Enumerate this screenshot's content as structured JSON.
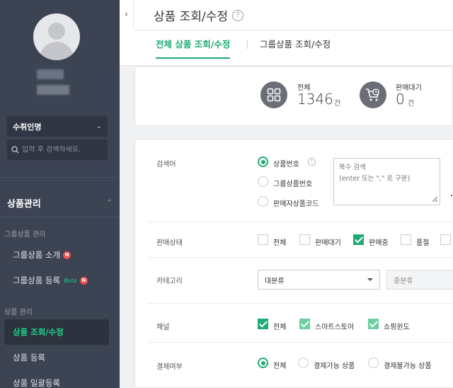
{
  "sidebar": {
    "store_select": "수취인명",
    "search_placeholder": "입력 후 검색하세요.",
    "menu_title": "상품관리",
    "groups": [
      {
        "label": "그룹상품 관리"
      },
      {
        "label": "상품 관리"
      }
    ],
    "items": [
      {
        "label": "그룹상품 소개",
        "badge": "N"
      },
      {
        "label": "그룹상품 등록",
        "beta": "Beta",
        "badge": "N"
      },
      {
        "label": "상품 조회/수정"
      },
      {
        "label": "상품 등록"
      },
      {
        "label": "상품 일괄등록"
      }
    ]
  },
  "header": {
    "title": "상품 조회/수정",
    "help": "?",
    "collapse_icon": "‹",
    "tabs": [
      {
        "label": "전체 상품 조회/수정"
      },
      {
        "label": "그룹상품 조회/수정"
      }
    ]
  },
  "summary": {
    "total": {
      "label": "전체",
      "value": "1346",
      "unit": "건"
    },
    "waiting": {
      "label": "판매대기",
      "value": "0",
      "unit": "건"
    }
  },
  "form": {
    "search": {
      "label": "검색어",
      "options": [
        "상품번호",
        "그룹상품번호",
        "판매자상품코드"
      ],
      "selected": "상품번호",
      "placeholder": "복수 검색\n(enter 또는 \",\" 로 구분)"
    },
    "status": {
      "label": "판매상태",
      "options": [
        "전체",
        "판매대기",
        "판매중",
        "품절"
      ],
      "checked": [
        false,
        false,
        true,
        false
      ]
    },
    "category": {
      "label": "카테고리",
      "major": "대분류",
      "middle": "중분류"
    },
    "channel": {
      "label": "채널",
      "options": [
        "전체",
        "스마트스토어",
        "쇼핑윈도"
      ],
      "checked": [
        true,
        true,
        true
      ]
    },
    "payment": {
      "label": "결제여부",
      "options": [
        "전체",
        "결제가능 상품",
        "결제불가능 상품"
      ],
      "selected": "전체"
    }
  },
  "colors": {
    "accent": "#1fab73",
    "sidebar_bg": "#3c4353",
    "active_text": "#1fd38a",
    "badge": "#f04d4d"
  }
}
